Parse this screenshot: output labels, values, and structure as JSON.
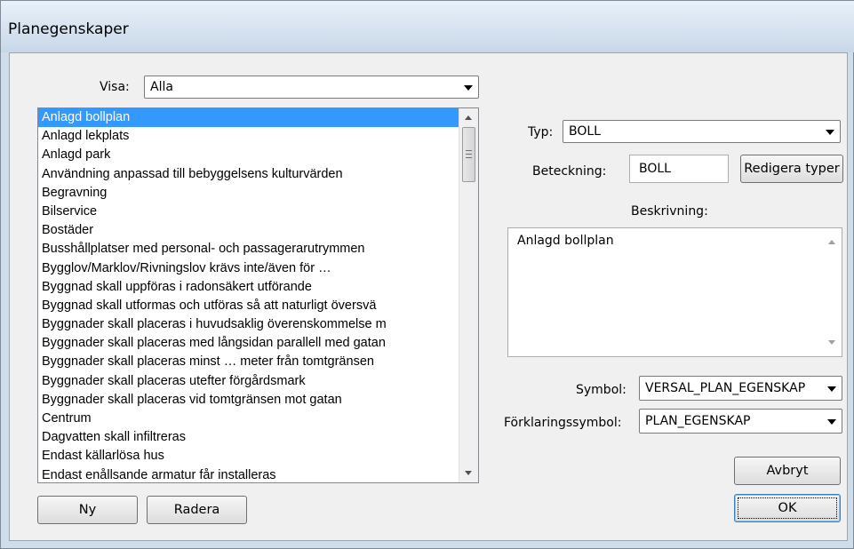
{
  "window": {
    "title": "Planegenskaper"
  },
  "filter": {
    "label": "Visa:",
    "value": "Alla"
  },
  "list": {
    "selected_index": 0,
    "items": [
      "Anlagd bollplan",
      "Anlagd lekplats",
      "Anlagd park",
      "Användning anpassad till bebyggelsens kulturvärden",
      "Begravning",
      "Bilservice",
      "Bostäder",
      "Busshållplatser med personal- och passagerarutrymmen",
      "Bygglov/Marklov/Rivningslov krävs inte/även för …",
      "Byggnad skall uppföras i radonsäkert utförande",
      "Byggnad skall utformas och utföras så att naturligt översvä",
      "Byggnader skall placeras i huvudsaklig överenskommelse m",
      "Byggnader skall placeras med långsidan parallell med gatan",
      "Byggnader skall placeras minst … meter från tomtgränsen",
      "Byggnader skall placeras utefter förgårdsmark",
      "Byggnader skall placeras vid tomtgränsen mot gatan",
      "Centrum",
      "Dagvatten skall infiltreras",
      "Endast källarlösa hus",
      "Endast enållsande armatur får installeras"
    ]
  },
  "buttons": {
    "new": "Ny",
    "delete": "Radera",
    "edit_types": "Redigera typer",
    "cancel": "Avbryt",
    "ok": "OK"
  },
  "details": {
    "type_label": "Typ:",
    "type_value": "BOLL",
    "designation_label": "Beteckning:",
    "designation_value": "BOLL",
    "description_label": "Beskrivning:",
    "description_value": "Anlagd bollplan",
    "symbol_label": "Symbol:",
    "symbol_value": "VERSAL_PLAN_EGENSKAP",
    "legend_symbol_label": "Förklaringssymbol:",
    "legend_symbol_value": "PLAN_EGENSKAP"
  },
  "colors": {
    "selection": "#3399ff",
    "window_frame": "#cfdcea",
    "dialog_bg": "#f0f0f0"
  }
}
